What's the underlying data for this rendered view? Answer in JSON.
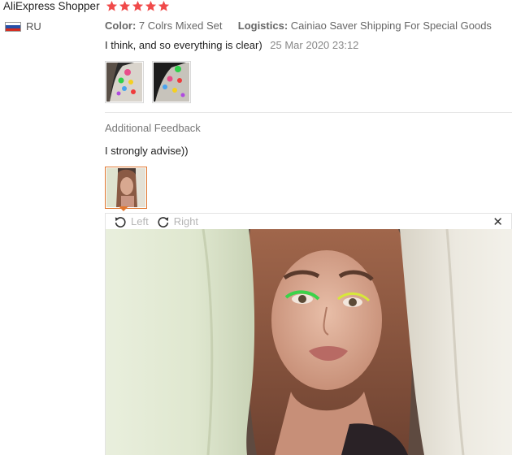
{
  "review": {
    "user_name": "AliExpress Shopper",
    "rating": 5,
    "country": "RU",
    "color_label": "Color:",
    "color_value": "7 Colrs Mixed Set",
    "logistics_label": "Logistics:",
    "logistics_value": "Cainiao Saver Shipping For Special Goods",
    "text": "I think, and so everything is clear)",
    "date": "25 Mar 2020 23:12"
  },
  "additional_feedback": {
    "title": "Additional Feedback",
    "text": "I strongly advise))"
  },
  "viewer": {
    "rotate_left_label": "Left",
    "rotate_right_label": "Right",
    "close_symbol": "✕"
  },
  "icons": {
    "star": "star-icon",
    "rotate_left": "rotate-left-icon",
    "rotate_right": "rotate-right-icon",
    "close": "close-icon",
    "flag": "russia-flag-icon"
  },
  "colors": {
    "star": "#f04a4a",
    "selected_border": "#e0762e",
    "muted_text": "#888888"
  }
}
